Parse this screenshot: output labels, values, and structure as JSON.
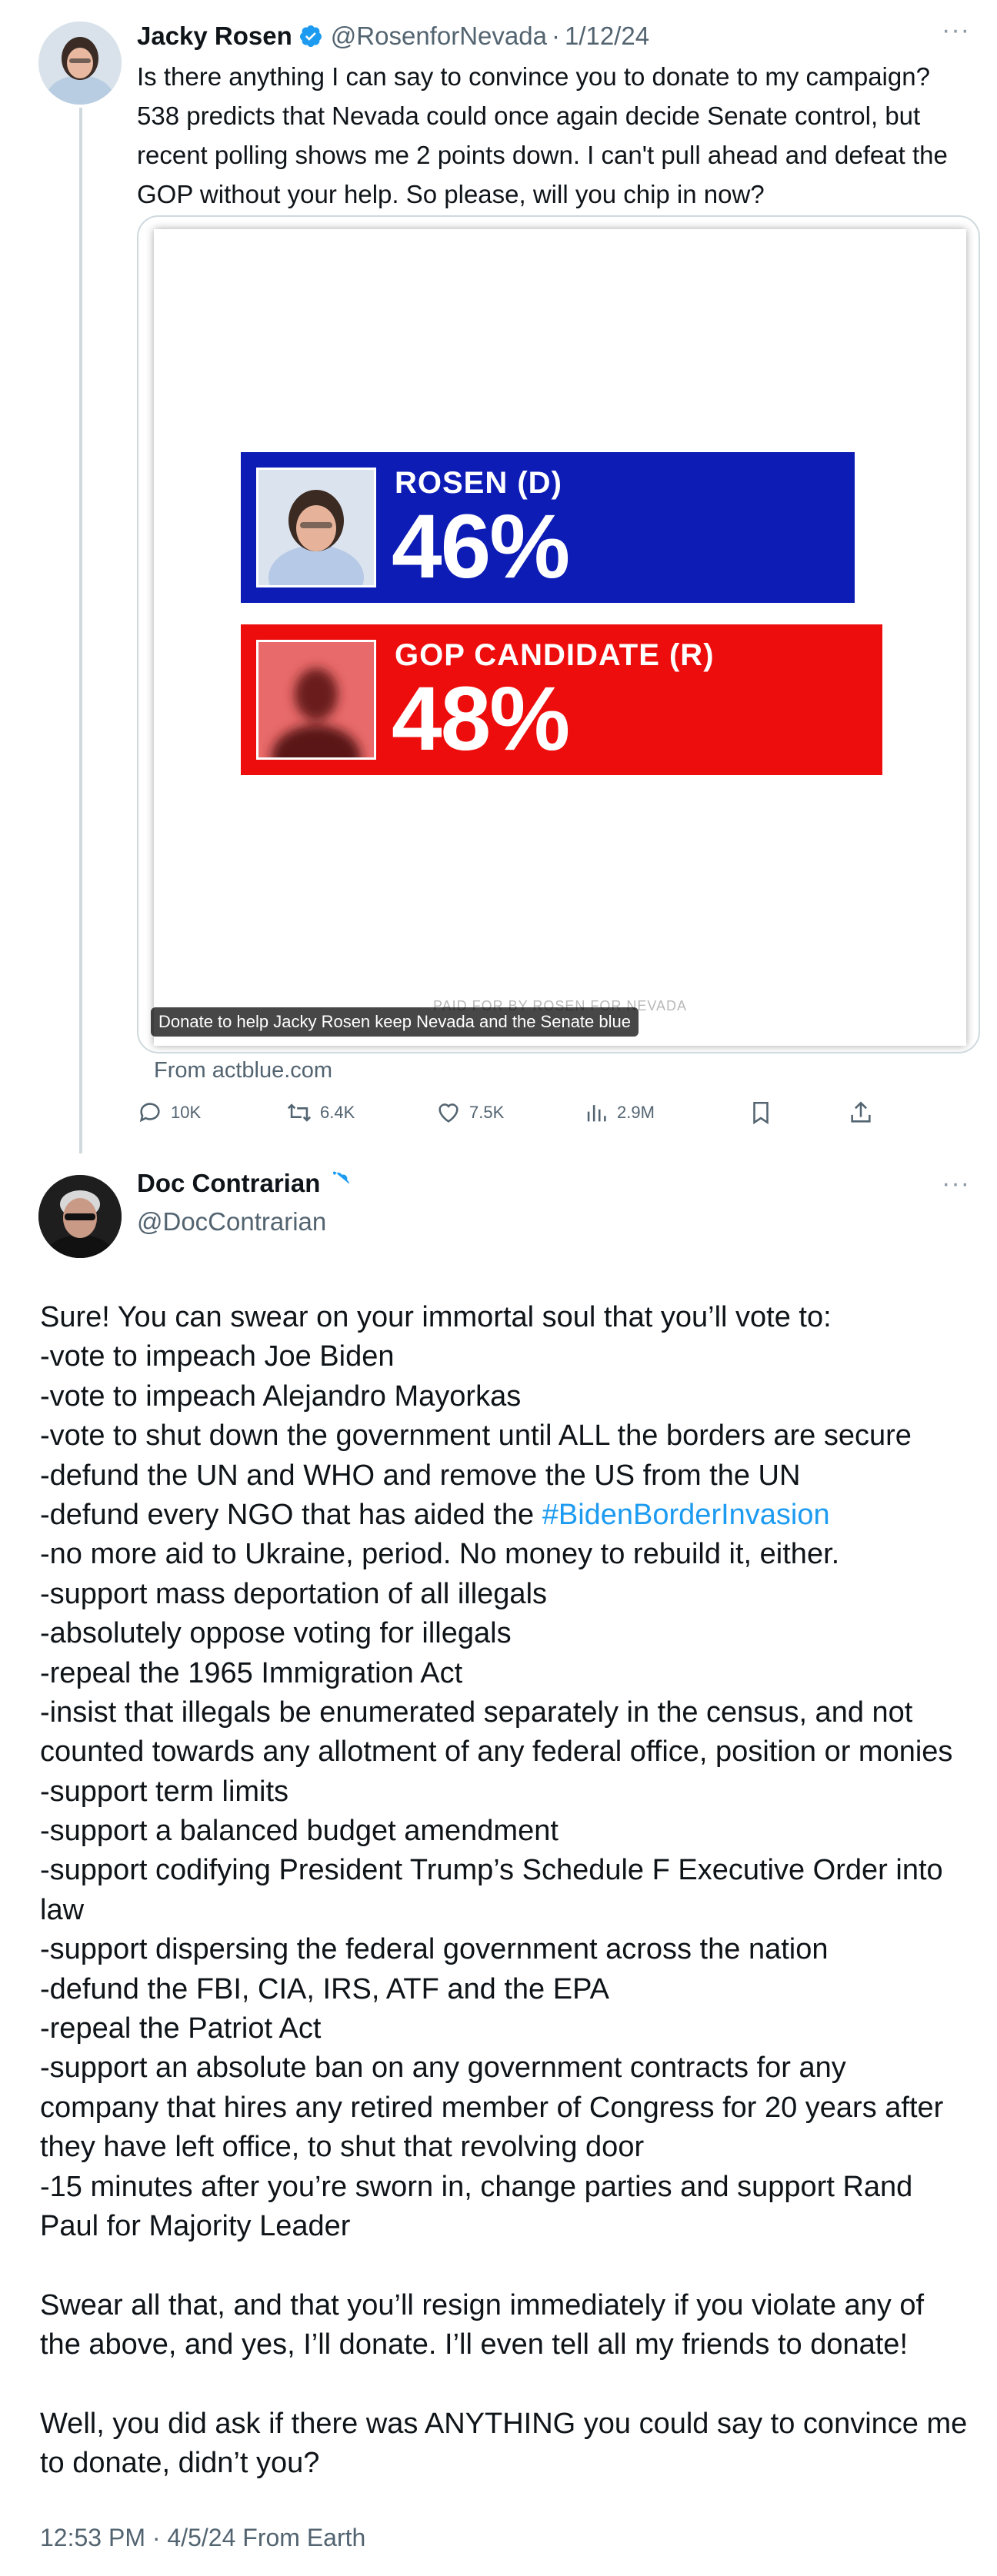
{
  "tweet1": {
    "name": "Jacky Rosen",
    "handle": "@RosenforNevada",
    "separator": "·",
    "date": "1/12/24",
    "more": "···",
    "text": "Is there anything I can say to convince you to donate to my campaign? 538 predicts that Nevada could once again decide Senate control, but recent polling shows me 2 points down. I can't pull ahead and defeat the GOP without your help. So please, will you chip in now?",
    "card": {
      "rosen_label": "ROSEN (D)",
      "rosen_value": "46%",
      "gop_label": "GOP CANDIDATE (R)",
      "gop_value": "48%",
      "paid_for": "PAID FOR BY ROSEN FOR NEVADA",
      "caption": "Donate to help Jacky Rosen keep Nevada and the Senate blue",
      "colors": {
        "rosen": "#0d1cb5",
        "gop": "#ed0d0d"
      }
    },
    "source": "From actblue.com",
    "actions": {
      "replies": "10K",
      "reposts": "6.4K",
      "likes": "7.5K",
      "views": "2.9M"
    }
  },
  "tweet2": {
    "name": "Doc Contrarian",
    "handle": "@DocContrarian",
    "more": "···",
    "lines": [
      "Sure! You can swear on your immortal soul that you’ll vote to:",
      "-vote to impeach Joe Biden",
      "-vote to impeach Alejandro Mayorkas",
      "-vote to shut down the government until ALL the borders are secure",
      "-defund the UN and WHO and remove the US from the UN",
      "-defund every NGO that has aided the ",
      "-no more aid to Ukraine, period. No money to rebuild it, either.",
      "-support mass deportation of all illegals",
      "-absolutely oppose voting for illegals",
      "-repeal the 1965 Immigration Act",
      "-insist that illegals be enumerated separately in the census, and not",
      "counted towards any allotment of any federal office, position or monies",
      "-support term limits",
      "-support a balanced budget amendment",
      "-support codifying President Trump’s Schedule F Executive Order into",
      "law",
      "-support dispersing the federal government across the nation",
      "-defund the FBI, CIA, IRS, ATF and the EPA",
      "-repeal the Patriot Act",
      "-support an absolute ban on any government contracts for any",
      "company that hires any retired member of Congress for 20 years after",
      "they have left office, to shut that revolving door",
      "-15 minutes after you’re sworn in, change parties and support Rand",
      "Paul for Majority Leader",
      "Swear all that, and that you’ll resign immediately if you violate any of",
      "the above, and yes, I’ll donate. I’ll even tell all my friends to donate!",
      "Well, you did ask if there was ANYTHING you could say to convince me",
      "to donate, didn’t you?"
    ],
    "hashtag": "#BidenBorderInvasion",
    "timestamp": "12:53 PM · 4/5/24 From Earth",
    "link_color": "#1d9bf0"
  }
}
